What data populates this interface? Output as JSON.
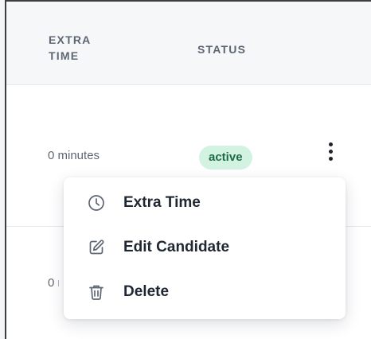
{
  "table": {
    "headers": {
      "extra_time": "EXTRA TIME",
      "status": "STATUS"
    },
    "rows": [
      {
        "extra_time": "0 minutes",
        "status": "active"
      },
      {
        "extra_time": "0 minutes"
      }
    ]
  },
  "row_actions": {
    "icon": "kebab-menu-icon",
    "menu": [
      {
        "label": "Extra Time",
        "icon": "clock-icon"
      },
      {
        "label": "Edit Candidate",
        "icon": "edit-icon"
      },
      {
        "label": "Delete",
        "icon": "trash-icon"
      }
    ]
  },
  "colors": {
    "status_active_bg": "#d3f3e2",
    "status_active_text": "#1d6b45",
    "header_text": "#5e6673",
    "menu_text": "#1f2733"
  }
}
